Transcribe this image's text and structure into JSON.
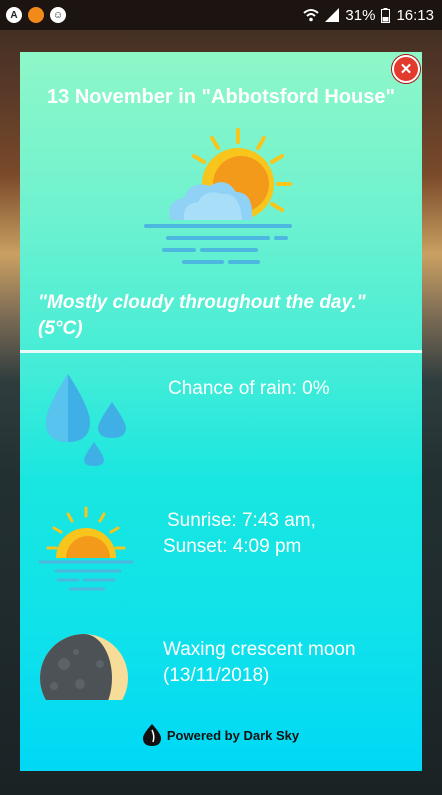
{
  "statusbar": {
    "battery": "31%",
    "time": "16:13",
    "icons": [
      "app-a-icon",
      "orange-dot-icon",
      "smiley-icon",
      "wifi-icon",
      "signal-icon",
      "battery-icon"
    ]
  },
  "card": {
    "title": "13 November in \"Abbotsford House\"",
    "summary": "\"Mostly cloudy throughout the day.\" (5°C)",
    "rain": "Chance of rain: 0%",
    "sunrise": "Sunrise: 7:43 am,",
    "sunset": "Sunset: 4:09 pm",
    "moon_phase": "Waxing crescent moon",
    "moon_date": "(13/11/2018)",
    "powered_by": "Powered by Dark Sky",
    "colors": {
      "sun": "#f7a81b",
      "sun_core": "#f3941a",
      "cloud": "#8fd2f5",
      "water": "#4cb7df"
    }
  }
}
